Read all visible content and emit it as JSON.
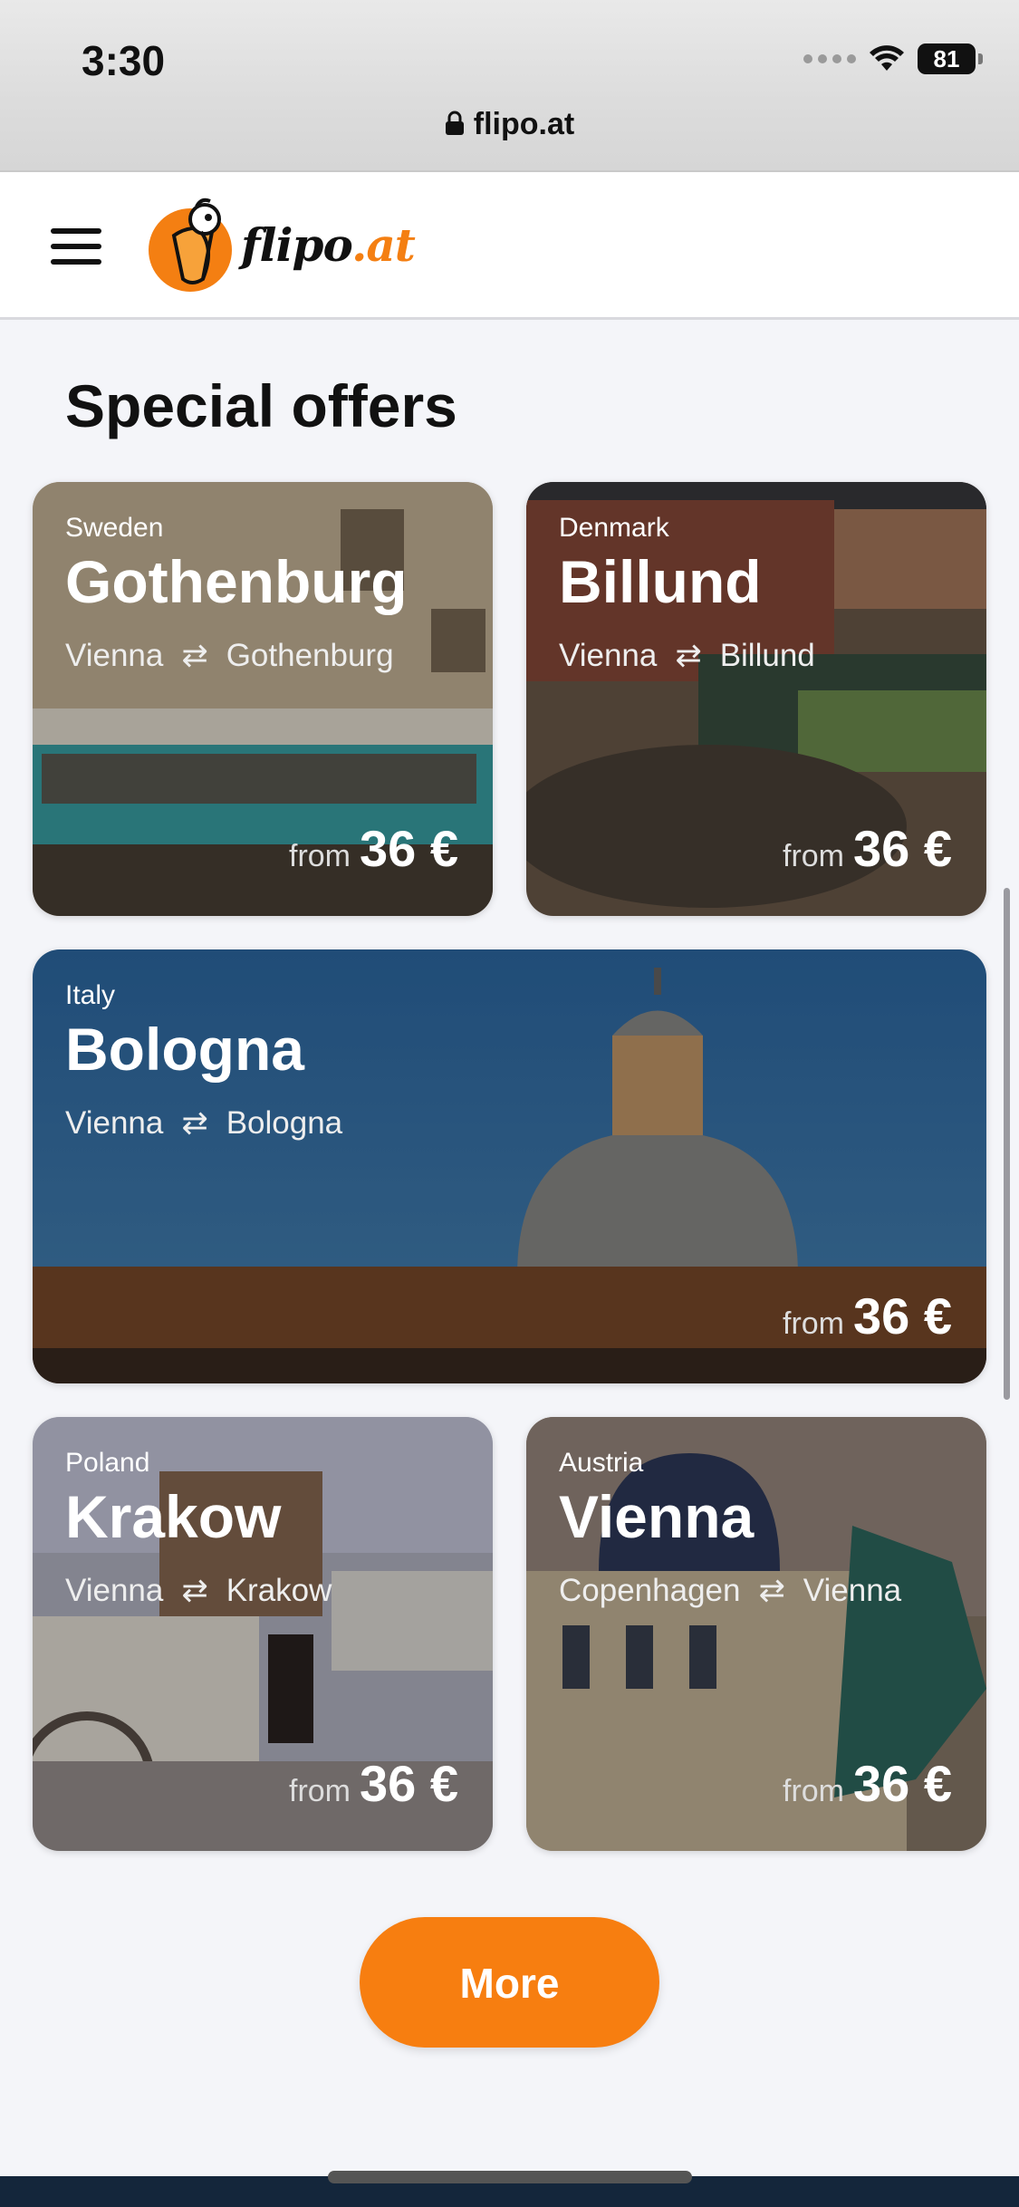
{
  "status_bar": {
    "time": "3:30",
    "battery": "81"
  },
  "browser": {
    "url": "flipo.at"
  },
  "header": {
    "logo_name": "flipo",
    "logo_tld": ".at"
  },
  "section": {
    "title": "Special offers"
  },
  "offers": [
    {
      "country": "Sweden",
      "city": "Gothenburg",
      "origin": "Vienna",
      "destination": "Gothenburg",
      "from_label": "from",
      "price": "36 €"
    },
    {
      "country": "Denmark",
      "city": "Billund",
      "origin": "Vienna",
      "destination": "Billund",
      "from_label": "from",
      "price": "36 €"
    },
    {
      "country": "Italy",
      "city": "Bologna",
      "origin": "Vienna",
      "destination": "Bologna",
      "from_label": "from",
      "price": "36 €"
    },
    {
      "country": "Poland",
      "city": "Krakow",
      "origin": "Vienna",
      "destination": "Krakow",
      "from_label": "from",
      "price": "36 €"
    },
    {
      "country": "Austria",
      "city": "Vienna",
      "origin": "Copenhagen",
      "destination": "Vienna",
      "from_label": "from",
      "price": "36 €"
    }
  ],
  "more_button": {
    "label": "More"
  },
  "colors": {
    "accent": "#f77e10",
    "footer": "#14263b",
    "page_bg": "#f4f5f9"
  }
}
